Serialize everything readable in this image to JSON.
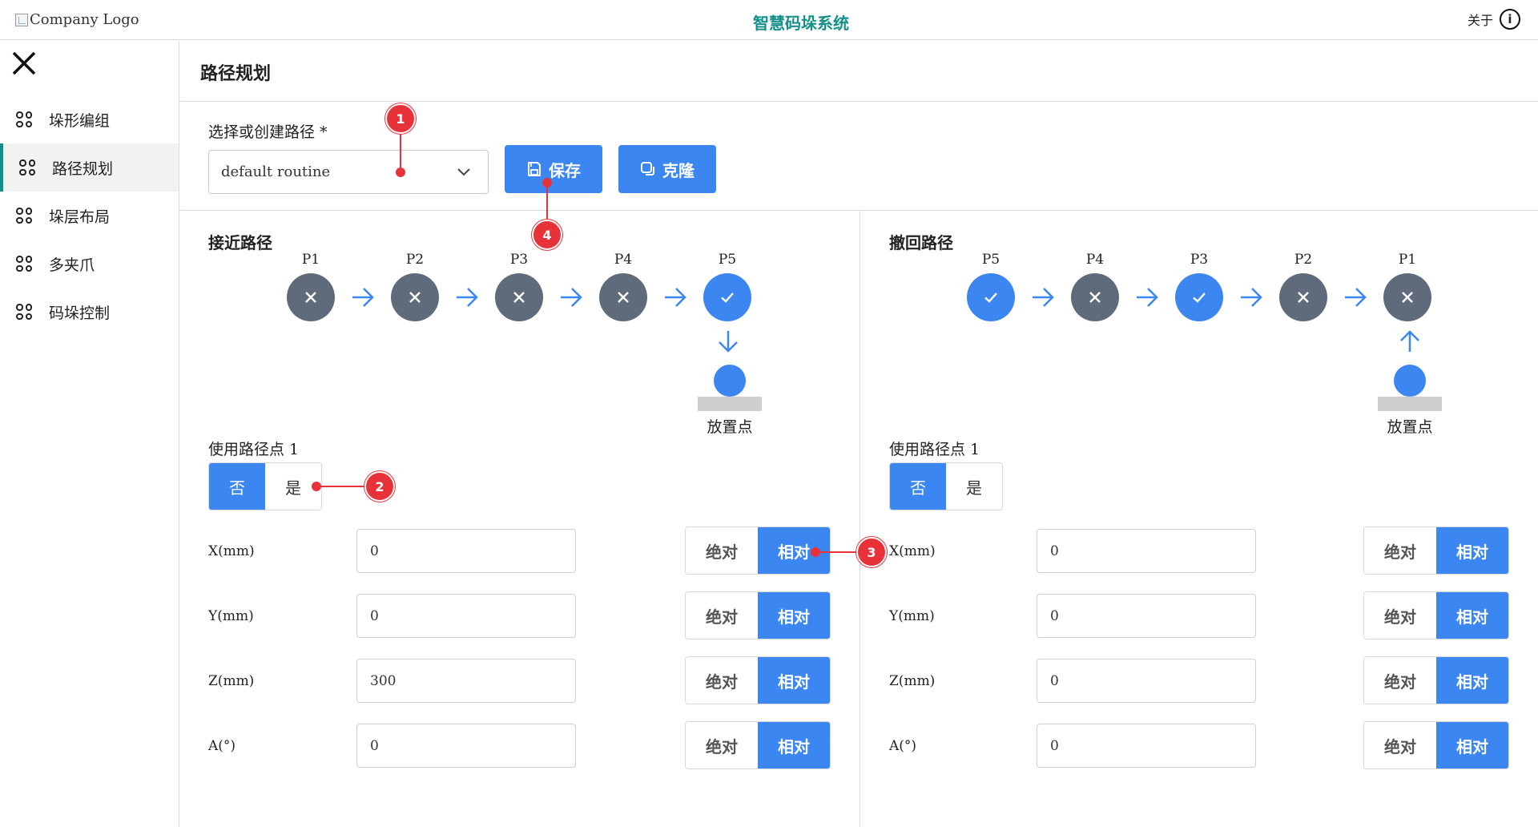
{
  "header": {
    "logo_alt": "Company Logo",
    "title": "智慧码垛系统",
    "about_label": "关于",
    "info_glyph": "i"
  },
  "sidebar": {
    "items": [
      {
        "label": "垛形编组",
        "active": false
      },
      {
        "label": "路径规划",
        "active": true
      },
      {
        "label": "垛层布局",
        "active": false
      },
      {
        "label": "多夹爪",
        "active": false
      },
      {
        "label": "码垛控制",
        "active": false
      }
    ]
  },
  "page": {
    "title": "路径规划",
    "routine_label": "选择或创建路径 *",
    "routine_value": "default routine",
    "save_label": "保存",
    "clone_label": "克隆"
  },
  "approach": {
    "title": "接近路径",
    "points": [
      {
        "label": "P1",
        "enabled": false
      },
      {
        "label": "P2",
        "enabled": false
      },
      {
        "label": "P3",
        "enabled": false
      },
      {
        "label": "P4",
        "enabled": false
      },
      {
        "label": "P5",
        "enabled": true
      }
    ],
    "drop_label": "放置点",
    "use_point_label": "使用路径点 1",
    "toggle": {
      "no": "否",
      "yes": "是",
      "selected": "no"
    },
    "fields": [
      {
        "label": "X(mm)",
        "value": "0",
        "abs": "绝对",
        "rel": "相对",
        "mode": "rel"
      },
      {
        "label": "Y(mm)",
        "value": "0",
        "abs": "绝对",
        "rel": "相对",
        "mode": "rel"
      },
      {
        "label": "Z(mm)",
        "value": "300",
        "abs": "绝对",
        "rel": "相对",
        "mode": "rel"
      },
      {
        "label": "A(°)",
        "value": "0",
        "abs": "绝对",
        "rel": "相对",
        "mode": "rel"
      }
    ]
  },
  "retract": {
    "title": "撤回路径",
    "points": [
      {
        "label": "P5",
        "enabled": true
      },
      {
        "label": "P4",
        "enabled": false
      },
      {
        "label": "P3",
        "enabled": true
      },
      {
        "label": "P2",
        "enabled": false
      },
      {
        "label": "P1",
        "enabled": false
      }
    ],
    "drop_label": "放置点",
    "use_point_label": "使用路径点 1",
    "toggle": {
      "no": "否",
      "yes": "是",
      "selected": "no"
    },
    "fields": [
      {
        "label": "X(mm)",
        "value": "0",
        "abs": "绝对",
        "rel": "相对",
        "mode": "rel"
      },
      {
        "label": "Y(mm)",
        "value": "0",
        "abs": "绝对",
        "rel": "相对",
        "mode": "rel"
      },
      {
        "label": "Z(mm)",
        "value": "0",
        "abs": "绝对",
        "rel": "相对",
        "mode": "rel"
      },
      {
        "label": "A(°)",
        "value": "0",
        "abs": "绝对",
        "rel": "相对",
        "mode": "rel"
      }
    ]
  },
  "annotations": [
    "1",
    "2",
    "3",
    "4"
  ],
  "colors": {
    "accent": "#3b86f0",
    "brand": "#14908a",
    "node_off": "#5f6b7a",
    "marker": "#e8323a"
  },
  "icons": {
    "menu_close": "close-icon",
    "nav": "grid-icon",
    "info": "info-icon",
    "save": "save-icon",
    "clone": "copy-icon"
  }
}
